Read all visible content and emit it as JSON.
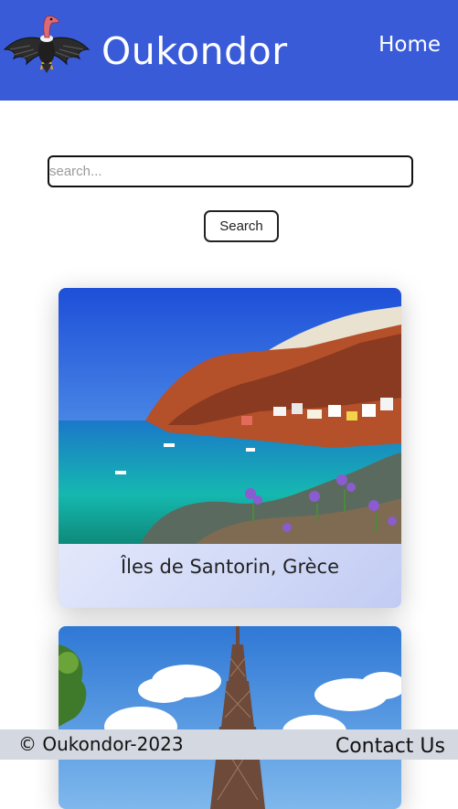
{
  "header": {
    "brand": "Oukondor",
    "nav_home": "Home",
    "color": "#3a5bd8"
  },
  "logo": {
    "icon": "condor-logo-icon"
  },
  "search": {
    "placeholder": "search...",
    "value": "",
    "button_label": "Search"
  },
  "destinations": [
    {
      "title": "Îles de Santorin, Grèce",
      "image": "santorini-photo"
    },
    {
      "title": "",
      "image": "eiffel-tower-photo"
    }
  ],
  "footer": {
    "copyright": "© Oukondor-2023",
    "contact": "Contact Us",
    "color": "#d4d8e0"
  }
}
